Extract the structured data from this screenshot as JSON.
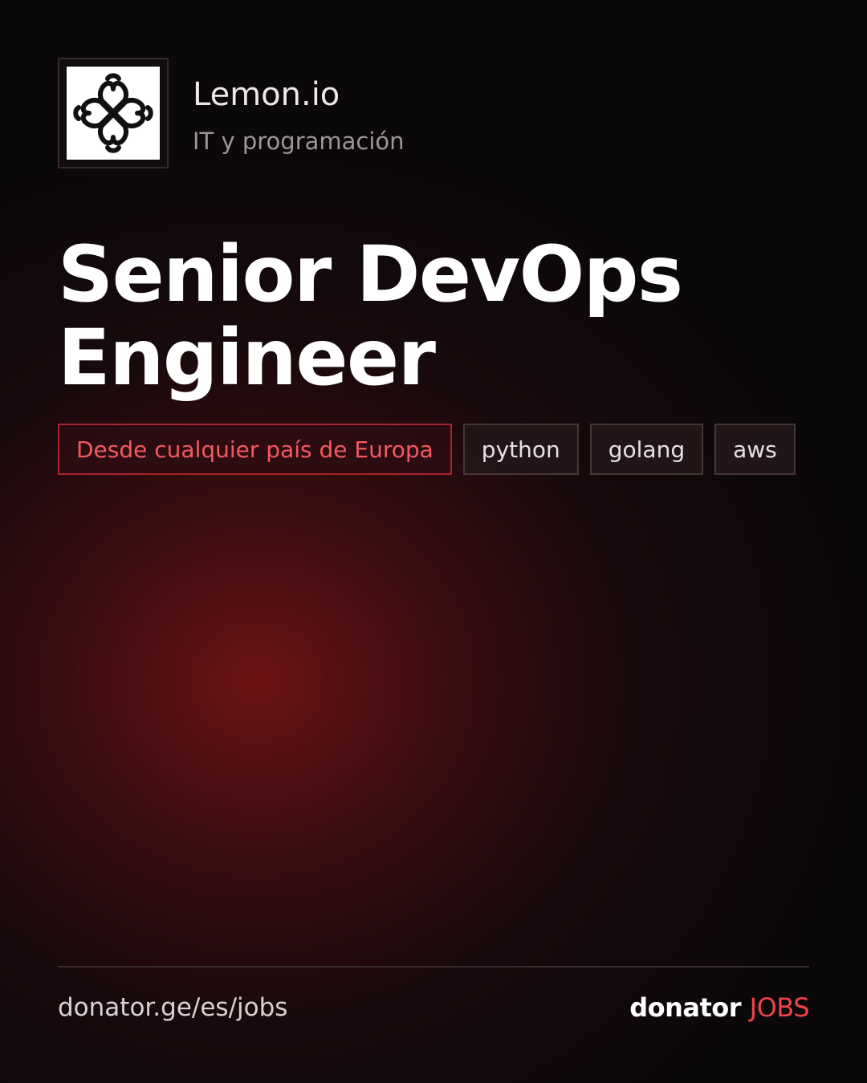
{
  "company": {
    "name": "Lemon.io",
    "category": "IT y programación",
    "logo_icon": "lemon-io-logo-icon"
  },
  "job": {
    "title": "Senior DevOps Engineer",
    "location_tag": "Desde cualquier país de Europa",
    "skill_tags": [
      "python",
      "golang",
      "aws"
    ]
  },
  "footer": {
    "url": "donator.ge/es/jobs",
    "brand_main": "donator",
    "brand_accent": "JOBS"
  },
  "colors": {
    "background": "#0b0809",
    "accent_red": "#ee4349",
    "location_border": "#a8262b",
    "tag_border": "#453638"
  }
}
